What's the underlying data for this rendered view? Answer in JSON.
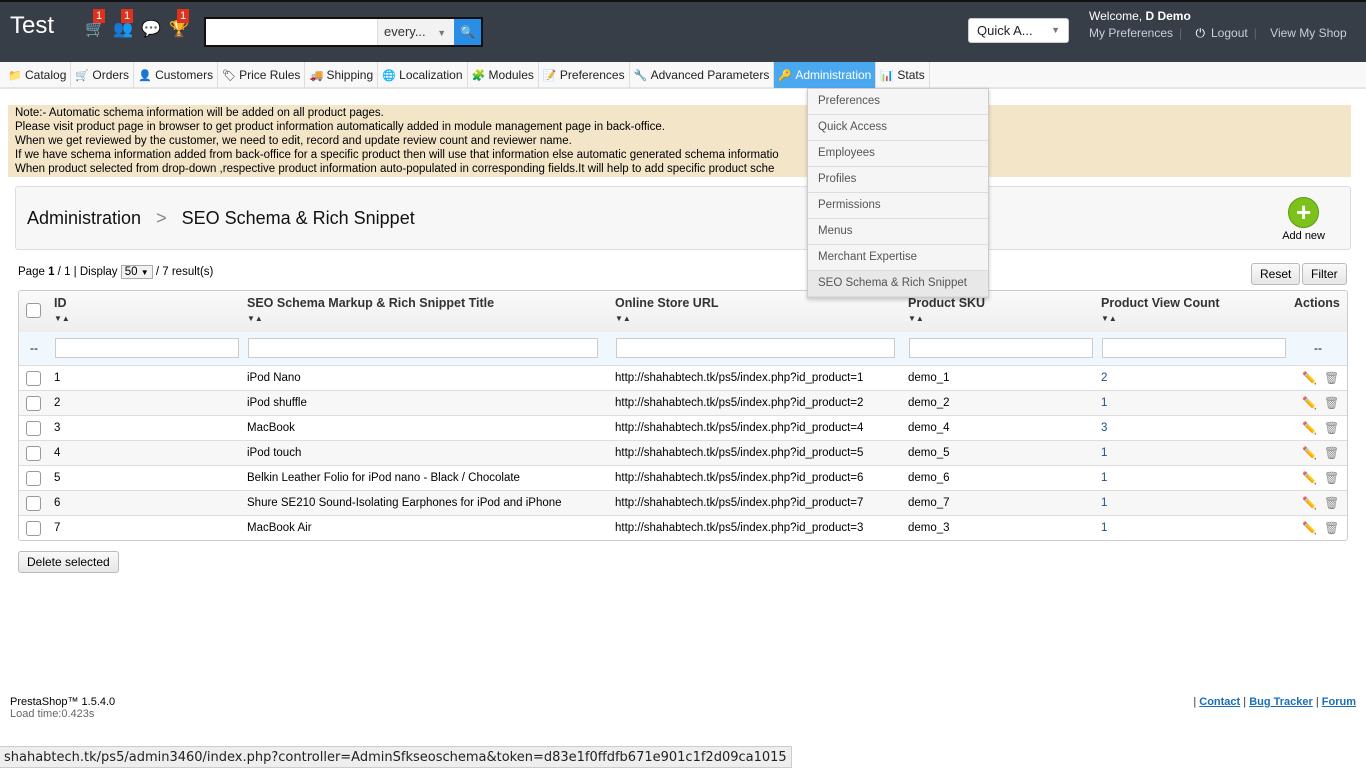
{
  "header": {
    "logo": "Test",
    "badges": {
      "cart": "1",
      "customers": "1",
      "trophy": "1"
    },
    "search": {
      "value": "",
      "scope": "every..."
    },
    "quick_access": "Quick A...",
    "welcome_prefix": "Welcome, ",
    "user": "D Demo",
    "my_preferences": "My Preferences",
    "logout": "Logout",
    "view_shop": "View My Shop"
  },
  "nav": [
    {
      "label": "Catalog",
      "icon": "folder-icon",
      "glyph": "📁"
    },
    {
      "label": "Orders",
      "icon": "cart-icon",
      "glyph": "🛒"
    },
    {
      "label": "Customers",
      "icon": "customer-icon",
      "glyph": "👤"
    },
    {
      "label": "Price Rules",
      "icon": "price-rules-icon",
      "glyph": "🏷"
    },
    {
      "label": "Shipping",
      "icon": "truck-icon",
      "glyph": "🚚"
    },
    {
      "label": "Localization",
      "icon": "globe-icon",
      "glyph": "🌐"
    },
    {
      "label": "Modules",
      "icon": "puzzle-icon",
      "glyph": "🧩"
    },
    {
      "label": "Preferences",
      "icon": "preferences-icon",
      "glyph": "📝"
    },
    {
      "label": "Advanced Parameters",
      "icon": "wrench-icon",
      "glyph": "🔧"
    },
    {
      "label": "Administration",
      "icon": "key-icon",
      "glyph": "🔑",
      "active": true
    },
    {
      "label": "Stats",
      "icon": "bar-chart-icon",
      "glyph": "📊"
    }
  ],
  "dropdown": [
    "Preferences",
    "Quick Access",
    "Employees",
    "Profiles",
    "Permissions",
    "Menus",
    "Merchant Expertise",
    "SEO Schema & Rich Snippet"
  ],
  "note": [
    "Note:- Automatic schema information will be added on all product pages.",
    "Please visit product page in browser to get product information automatically added in module management page in back-office.",
    "When we get reviewed by the customer, we need to edit, record and update review count and reviewer name.",
    "If we have schema information added from back-office for a specific product then will use that information else automatic generated schema informatio",
    "When product selected from drop-down ,respective product information auto-populated in corresponding fields.It will help to add specific product sche"
  ],
  "breadcrumb": {
    "parent": "Administration",
    "separator": ">",
    "current": "SEO Schema & Rich Snippet"
  },
  "add_new": "Add new",
  "pagination": {
    "page_label": "Page ",
    "page": "1",
    "sep": " / ",
    "total_pages": "1",
    "display_label": " | Display ",
    "per_page": "50",
    "results": " / 7 result(s)"
  },
  "buttons": {
    "reset": "Reset",
    "filter": "Filter",
    "delete_selected": "Delete selected"
  },
  "table": {
    "columns": [
      "ID",
      "SEO Schema Markup & Rich Snippet Title",
      "Online Store URL",
      "Product SKU",
      "Product View Count",
      "Actions"
    ],
    "filter_placeholder": "--",
    "rows": [
      [
        "1",
        "iPod Nano",
        "http://shahabtech.tk/ps5/index.php?id_product=1",
        "demo_1",
        "2"
      ],
      [
        "2",
        "iPod shuffle",
        "http://shahabtech.tk/ps5/index.php?id_product=2",
        "demo_2",
        "1"
      ],
      [
        "3",
        "MacBook",
        "http://shahabtech.tk/ps5/index.php?id_product=4",
        "demo_4",
        "3"
      ],
      [
        "4",
        "iPod touch",
        "http://shahabtech.tk/ps5/index.php?id_product=5",
        "demo_5",
        "1"
      ],
      [
        "5",
        "Belkin Leather Folio for iPod nano - Black / Chocolate",
        "http://shahabtech.tk/ps5/index.php?id_product=6",
        "demo_6",
        "1"
      ],
      [
        "6",
        "Shure SE210 Sound-Isolating Earphones for iPod and iPhone",
        "http://shahabtech.tk/ps5/index.php?id_product=7",
        "demo_7",
        "1"
      ],
      [
        "7",
        "MacBook Air",
        "http://shahabtech.tk/ps5/index.php?id_product=3",
        "demo_3",
        "1"
      ]
    ]
  },
  "footer": {
    "version": "PrestaShop™ 1.5.4.0",
    "load_time": "Load time:0.423s",
    "contact": "Contact",
    "bug_tracker": "Bug Tracker",
    "forum": "Forum"
  },
  "status_url": "shahabtech.tk/ps5/admin3460/index.php?controller=AdminSfkseoschema&token=d83e1f0ffdfb671e901c1f2d09ca1015"
}
